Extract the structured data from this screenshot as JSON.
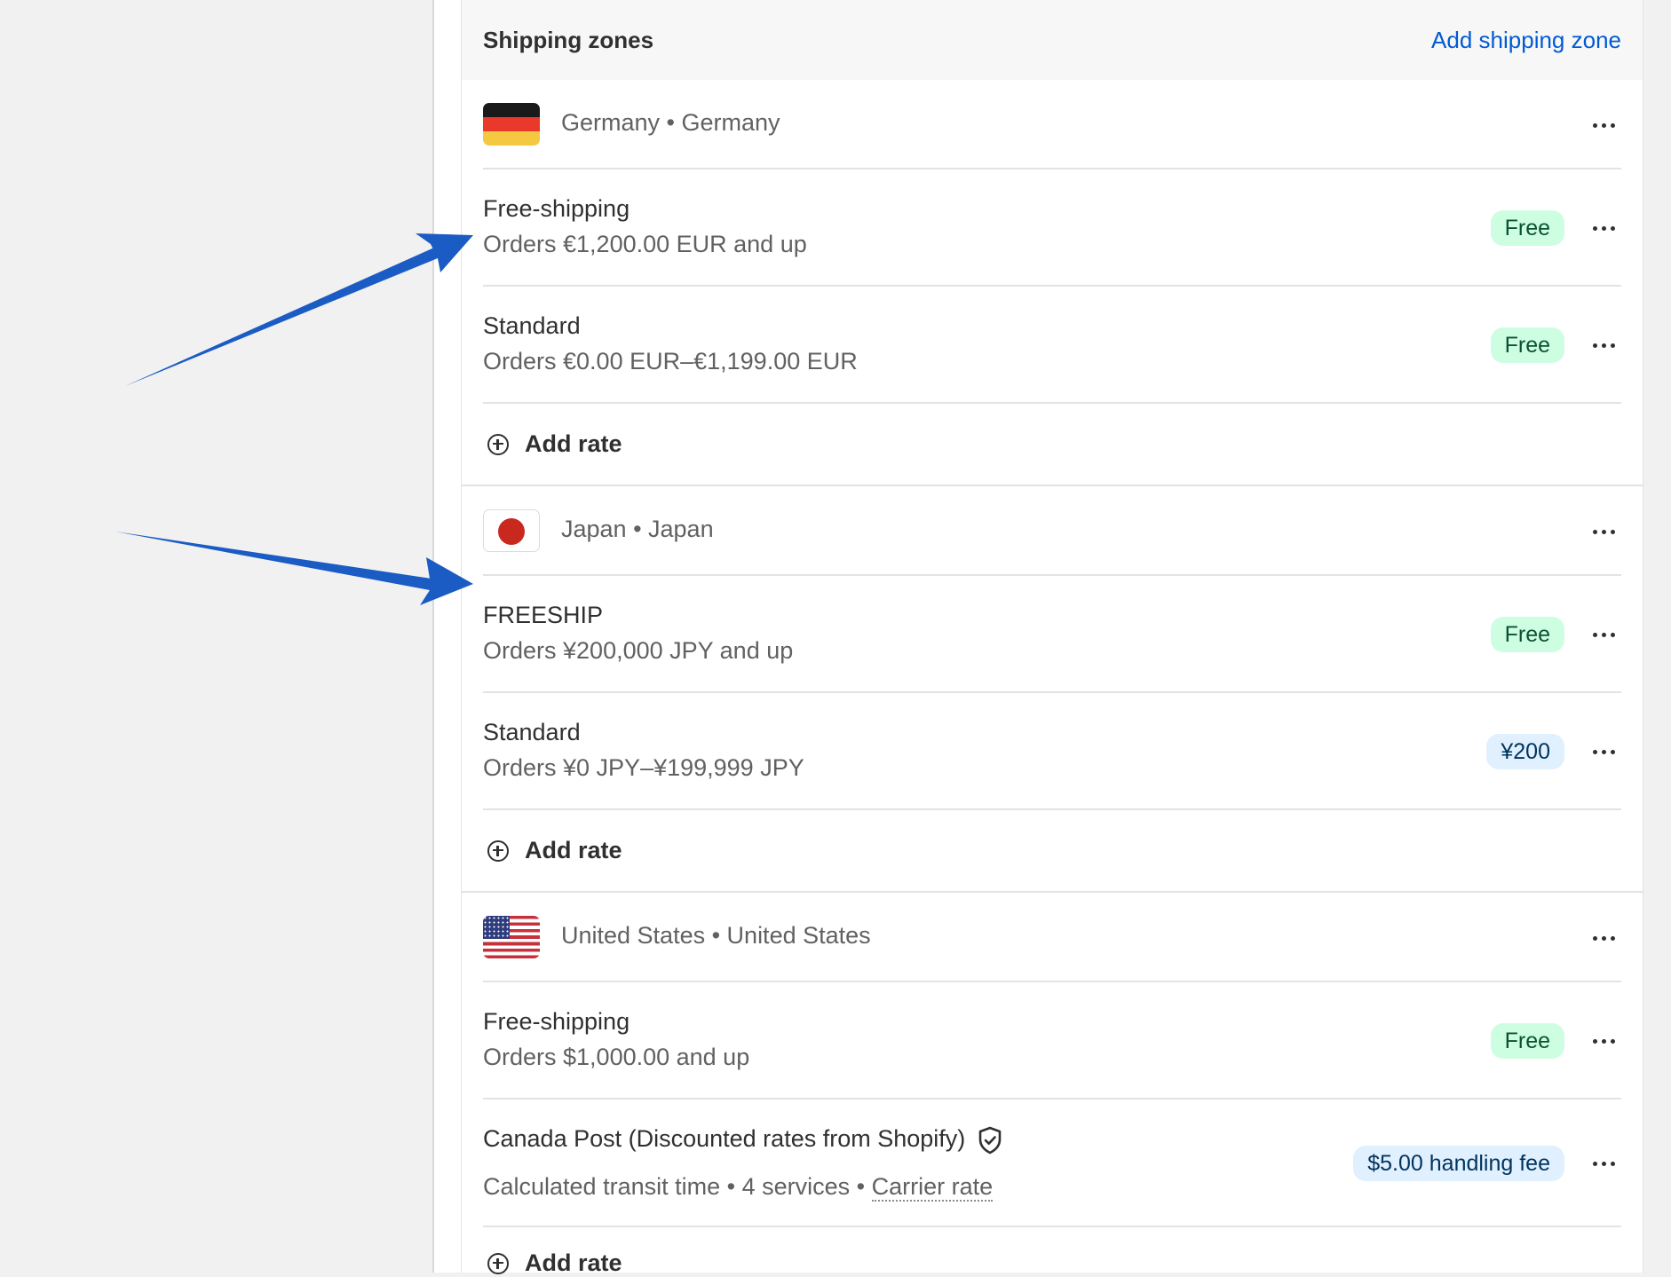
{
  "card": {
    "title": "Shipping zones",
    "add_zone_label": "Add shipping zone"
  },
  "zones": [
    {
      "name": "Germany • Germany",
      "flag": "germany-flag",
      "rates": [
        {
          "name": "Free-shipping",
          "condition": "Orders €1,200.00 EUR and up",
          "price": "Free"
        },
        {
          "name": "Standard",
          "condition": "Orders €0.00 EUR–€1,199.00 EUR",
          "price": "Free"
        }
      ],
      "add_rate_label": "Add rate"
    },
    {
      "name": "Japan • Japan",
      "flag": "japan-flag",
      "rates": [
        {
          "name": "FREESHIP",
          "condition": "Orders ¥200,000 JPY and up",
          "price": "Free"
        },
        {
          "name": "Standard",
          "condition": "Orders ¥0 JPY–¥199,999 JPY",
          "price": "¥200"
        }
      ],
      "add_rate_label": "Add rate"
    },
    {
      "name": "United States • United States",
      "flag": "united-states-flag",
      "rates": [
        {
          "name": "Free-shipping",
          "condition": "Orders $1,000.00 and up",
          "price": "Free"
        },
        {
          "name": "Canada Post (Discounted rates from Shopify)",
          "condition_parts": [
            "Calculated transit time",
            " • ",
            "4 services",
            " • ",
            "Carrier rate"
          ],
          "price": "$5.00 handling fee"
        }
      ],
      "add_rate_label": "Add rate"
    }
  ],
  "colors": {
    "link": "#005bd3",
    "badge_free_bg": "#cdfee1",
    "badge_price_bg": "#e0f0ff",
    "annotation_arrow": "#1a5bc4"
  },
  "icons": [
    "more-horizontal-icon",
    "plus-circle-icon",
    "shield-check-icon"
  ]
}
